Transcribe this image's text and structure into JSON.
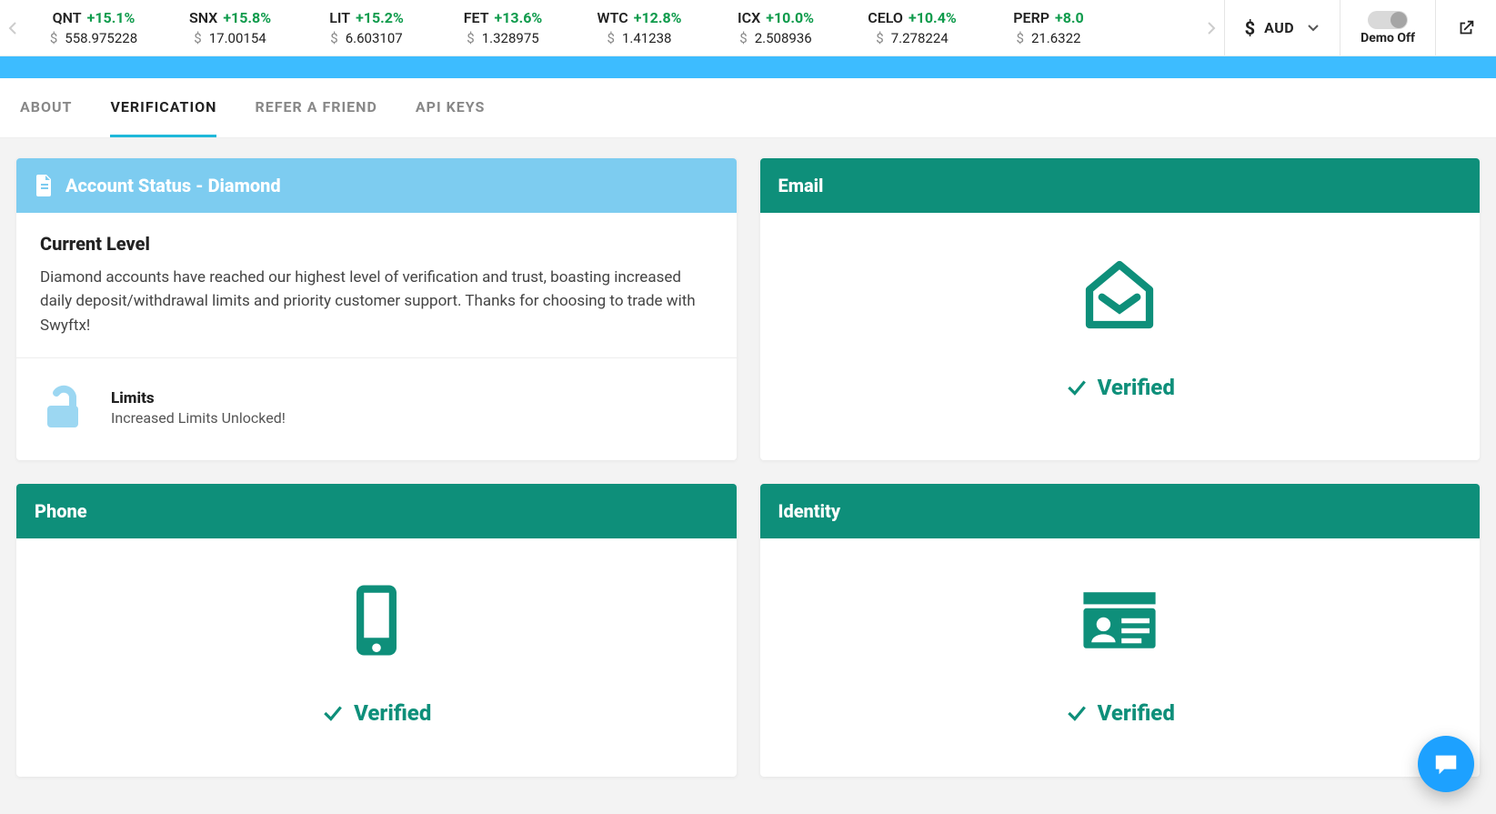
{
  "ticker": {
    "items": [
      {
        "sym": "QNT",
        "change": "+15.1%",
        "price": "558.975228"
      },
      {
        "sym": "SNX",
        "change": "+15.8%",
        "price": "17.00154"
      },
      {
        "sym": "LIT",
        "change": "+15.2%",
        "price": "6.603107"
      },
      {
        "sym": "FET",
        "change": "+13.6%",
        "price": "1.328975"
      },
      {
        "sym": "WTC",
        "change": "+12.8%",
        "price": "1.41238"
      },
      {
        "sym": "ICX",
        "change": "+10.0%",
        "price": "2.508936"
      },
      {
        "sym": "CELO",
        "change": "+10.4%",
        "price": "7.278224"
      },
      {
        "sym": "PERP",
        "change": "+8.0",
        "price": "21.6322"
      }
    ],
    "currency": "AUD",
    "demo_label": "Demo Off"
  },
  "tabs": {
    "about": "ABOUT",
    "verification": "VERIFICATION",
    "refer": "REFER A FRIEND",
    "api": "API KEYS"
  },
  "status_card": {
    "header": "Account Status - Diamond",
    "title": "Current Level",
    "desc": "Diamond accounts have reached our highest level of verification and trust, boasting increased daily deposit/withdrawal limits and priority customer support. Thanks for choosing to trade with Swyftx!",
    "limits_title": "Limits",
    "limits_sub": "Increased Limits Unlocked!"
  },
  "verify": {
    "email_header": "Email",
    "phone_header": "Phone",
    "identity_header": "Identity",
    "verified_label": "Verified"
  }
}
